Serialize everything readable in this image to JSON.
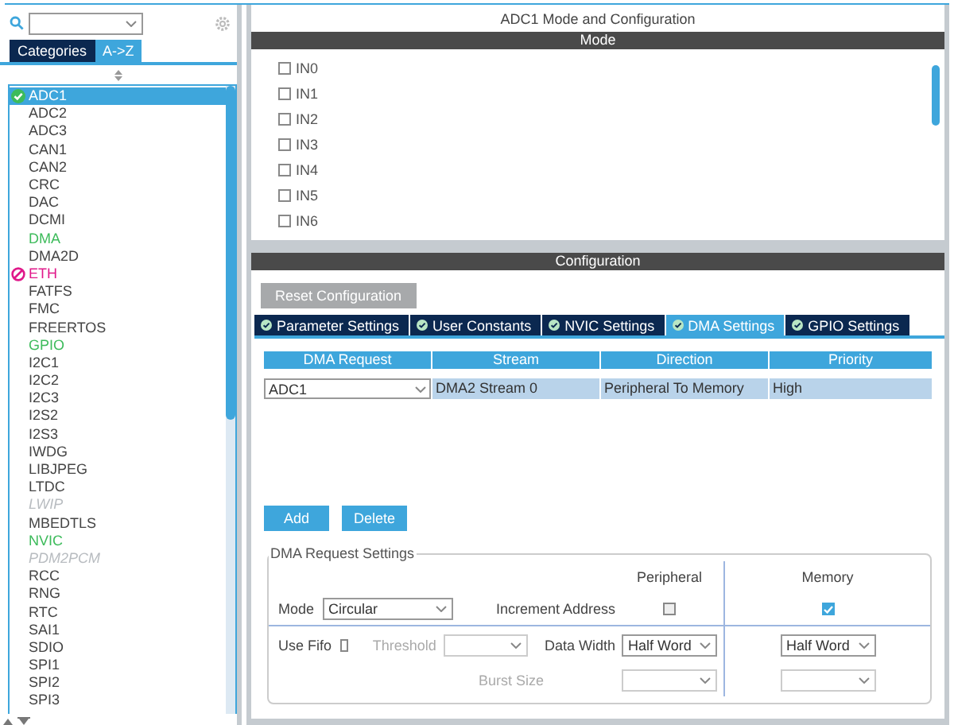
{
  "sidebar": {
    "tabs": [
      {
        "label": "Categories",
        "selected": false
      },
      {
        "label": "A->Z",
        "selected": true
      }
    ],
    "items": [
      {
        "label": "ADC1",
        "kind": "ok",
        "selected": true
      },
      {
        "label": "ADC2",
        "kind": "plain",
        "selected": false
      },
      {
        "label": "ADC3",
        "kind": "plain",
        "selected": false
      },
      {
        "label": "CAN1",
        "kind": "plain",
        "selected": false
      },
      {
        "label": "CAN2",
        "kind": "plain",
        "selected": false
      },
      {
        "label": "CRC",
        "kind": "plain",
        "selected": false
      },
      {
        "label": "DAC",
        "kind": "plain",
        "selected": false
      },
      {
        "label": "DCMI",
        "kind": "plain",
        "selected": false
      },
      {
        "label": "DMA",
        "kind": "active",
        "selected": false
      },
      {
        "label": "DMA2D",
        "kind": "plain",
        "selected": false
      },
      {
        "label": "ETH",
        "kind": "error",
        "selected": false
      },
      {
        "label": "FATFS",
        "kind": "plain",
        "selected": false
      },
      {
        "label": "FMC",
        "kind": "plain",
        "selected": false
      },
      {
        "label": "FREERTOS",
        "kind": "plain",
        "selected": false
      },
      {
        "label": "GPIO",
        "kind": "active",
        "selected": false
      },
      {
        "label": "I2C1",
        "kind": "plain",
        "selected": false
      },
      {
        "label": "I2C2",
        "kind": "plain",
        "selected": false
      },
      {
        "label": "I2C3",
        "kind": "plain",
        "selected": false
      },
      {
        "label": "I2S2",
        "kind": "plain",
        "selected": false
      },
      {
        "label": "I2S3",
        "kind": "plain",
        "selected": false
      },
      {
        "label": "IWDG",
        "kind": "plain",
        "selected": false
      },
      {
        "label": "LIBJPEG",
        "kind": "plain",
        "selected": false
      },
      {
        "label": "LTDC",
        "kind": "plain",
        "selected": false
      },
      {
        "label": "LWIP",
        "kind": "disabled",
        "selected": false
      },
      {
        "label": "MBEDTLS",
        "kind": "plain",
        "selected": false
      },
      {
        "label": "NVIC",
        "kind": "active",
        "selected": false
      },
      {
        "label": "PDM2PCM",
        "kind": "disabled",
        "selected": false
      },
      {
        "label": "RCC",
        "kind": "plain",
        "selected": false
      },
      {
        "label": "RNG",
        "kind": "plain",
        "selected": false
      },
      {
        "label": "RTC",
        "kind": "plain",
        "selected": false
      },
      {
        "label": "SAI1",
        "kind": "plain",
        "selected": false
      },
      {
        "label": "SDIO",
        "kind": "plain",
        "selected": false
      },
      {
        "label": "SPI1",
        "kind": "plain",
        "selected": false
      },
      {
        "label": "SPI2",
        "kind": "plain",
        "selected": false
      },
      {
        "label": "SPI3",
        "kind": "plain",
        "selected": false
      }
    ]
  },
  "main": {
    "title": "ADC1 Mode and Configuration",
    "mode_header": "Mode",
    "mode_channels": [
      {
        "label": "IN0",
        "checked": false
      },
      {
        "label": "IN1",
        "checked": false
      },
      {
        "label": "IN2",
        "checked": false
      },
      {
        "label": "IN3",
        "checked": false
      },
      {
        "label": "IN4",
        "checked": false
      },
      {
        "label": "IN5",
        "checked": false
      },
      {
        "label": "IN6",
        "checked": false
      }
    ],
    "config_header": "Configuration",
    "reset_button": "Reset Configuration",
    "tabs": [
      {
        "label": "Parameter Settings",
        "selected": false
      },
      {
        "label": "User Constants",
        "selected": false
      },
      {
        "label": "NVIC Settings",
        "selected": false
      },
      {
        "label": "DMA Settings",
        "selected": true
      },
      {
        "label": "GPIO Settings",
        "selected": false
      }
    ],
    "table": {
      "columns": [
        "DMA Request",
        "Stream",
        "Direction",
        "Priority"
      ],
      "rows": [
        {
          "request": "ADC1",
          "stream": "DMA2 Stream 0",
          "direction": "Peripheral To Memory",
          "priority": "High",
          "selected": true
        }
      ]
    },
    "buttons": [
      "Add",
      "Delete"
    ],
    "settings": {
      "legend": "DMA Request Settings",
      "peripheral_header": "Peripheral",
      "memory_header": "Memory",
      "mode_label": "Mode",
      "mode_value": "Circular",
      "increment_label": "Increment Address",
      "peripheral_increment": false,
      "memory_increment": true,
      "fifo_label": "Use Fifo",
      "use_fifo": false,
      "threshold_label": "Threshold",
      "data_width_label": "Data Width",
      "peripheral_width": "Half Word",
      "memory_width": "Half Word",
      "burst_label": "Burst Size"
    }
  }
}
